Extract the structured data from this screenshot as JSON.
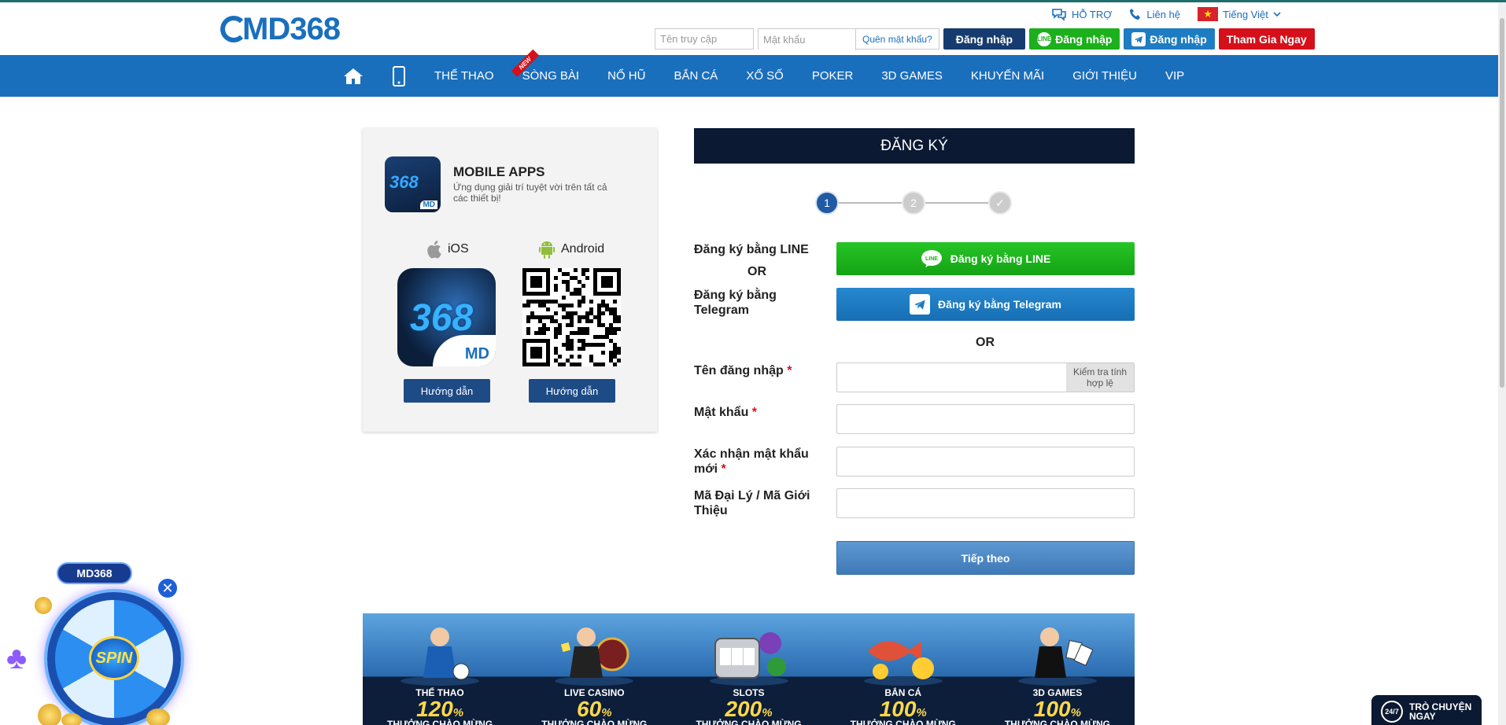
{
  "header": {
    "logo_text": "MD368",
    "support_label": "HỖ TRỢ",
    "contact_label": "Liên hệ",
    "language_label": "Tiếng Việt",
    "username_placeholder": "Tên truy cập",
    "password_placeholder": "Mật khẩu",
    "forgot_label": "Quên mật khẩu?",
    "login_label": "Đăng nhập",
    "line_login_label": "Đăng nhập",
    "telegram_login_label": "Đăng nhập",
    "join_label": "Tham Gia Ngay"
  },
  "nav": {
    "items": [
      "THỂ THAO",
      "SÒNG BÀI",
      "NỔ HŨ",
      "BẮN CÁ",
      "XỔ SỐ",
      "POKER",
      "3D GAMES",
      "KHUYẾN MÃI",
      "GIỚI THIỆU",
      "VIP"
    ],
    "new_badge": "NEW"
  },
  "apps": {
    "title": "MOBILE APPS",
    "subtitle": "Ứng dụng giải trí tuyệt vời trên tất cả các thiết bị!",
    "ios_label": "iOS",
    "android_label": "Android",
    "app_number": "368",
    "app_brand": "MD",
    "guide_label": "Hướng dẫn"
  },
  "register": {
    "title": "ĐĂNG KÝ",
    "steps": [
      "1",
      "2",
      "✓"
    ],
    "line_label": "Đăng ký bằng LINE",
    "or_label": "OR",
    "telegram_label_line1": "Đăng ký bằng",
    "telegram_label_line2": "Telegram",
    "line_button": "Đăng ký bằng LINE",
    "telegram_button": "Đăng ký bằng Telegram",
    "username_label": "Tên đăng nhập",
    "check_button_line1": "Kiểm tra tính",
    "check_button_line2": "hợp lệ",
    "password_label": "Mật khẩu",
    "confirm_label_line1": "Xác nhận mật khẩu",
    "confirm_label_line2": "mới",
    "agent_label_line1": "Mã Đại Lý / Mã Giới",
    "agent_label_line2": "Thiệu",
    "required_mark": "*",
    "next_button": "Tiếp theo"
  },
  "promo": [
    {
      "name": "THỂ THAO",
      "percent": "120",
      "sub": "THƯỞNG CHÀO MỪNG"
    },
    {
      "name": "LIVE CASINO",
      "percent": "60",
      "sub": "THƯỞNG CHÀO MỪNG"
    },
    {
      "name": "SLOTS",
      "percent": "200",
      "sub": "THƯỞNG CHÀO MỪNG"
    },
    {
      "name": "BẮN CÁ",
      "percent": "100",
      "sub": "THƯỞNG CHÀO MỪNG"
    },
    {
      "name": "3D GAMES",
      "percent": "100",
      "sub": "THƯỞNG CHÀO MỪNG"
    }
  ],
  "spin": {
    "logo": "MD368",
    "label": "SPIN"
  },
  "chat": {
    "badge": "24/7",
    "line1": "TRÒ CHUYỆN",
    "line2": "NGAY"
  },
  "colors": {
    "brand_blue": "#1a6fbd",
    "navy": "#0b1932",
    "line_green": "#1cb01c",
    "join_red": "#d6101a"
  }
}
